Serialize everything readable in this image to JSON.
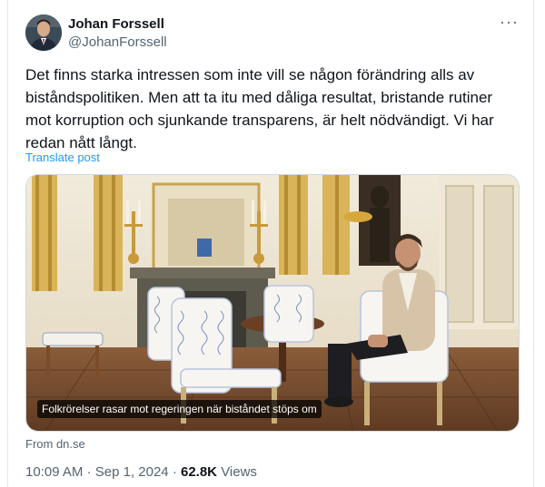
{
  "author": {
    "name": "Johan Forssell",
    "handle": "@JohanForssell"
  },
  "tweet": {
    "text": "Det finns starka intressen som inte vill se någon förändring alls av biståndspolitiken. Men att ta itu med dåliga resultat, bristande rutiner mot korruption och sjunkande transparens, är helt nödvändigt. Vi har redan nått långt.",
    "translate_label": "Translate post"
  },
  "media": {
    "caption": "Folkrörelser rasar mot regeringen när biståndet stöps om",
    "source": "From dn.se"
  },
  "meta": {
    "time": "10:09 AM",
    "separator": "·",
    "date": "Sep 1, 2024",
    "views_count": "62.8K",
    "views_label": "Views"
  },
  "icons": {
    "more": "more-horizontal-icon"
  },
  "colors": {
    "link": "#1d9bf0",
    "secondary_text": "#536471",
    "primary_text": "#0f1419"
  }
}
